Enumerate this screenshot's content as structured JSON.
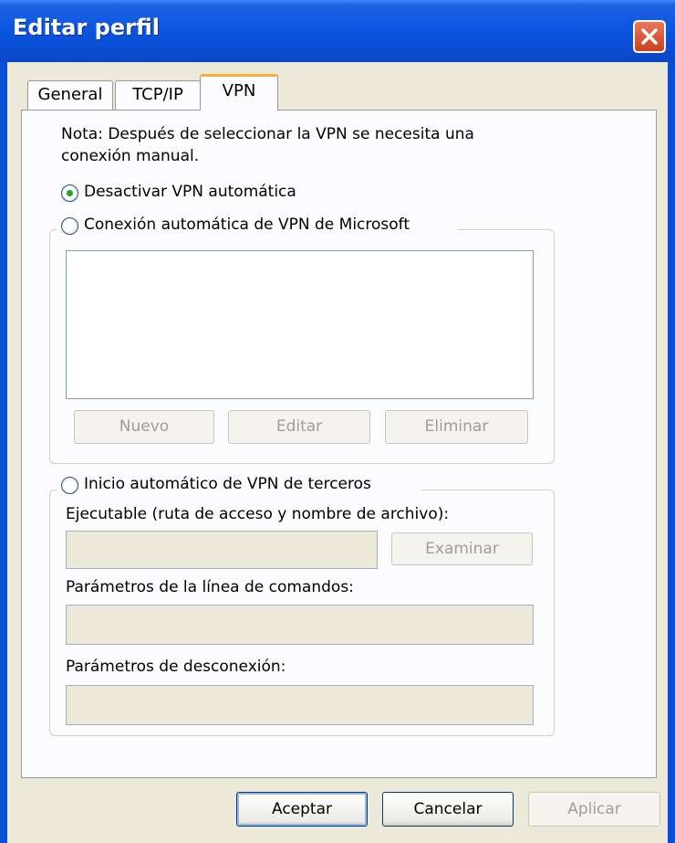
{
  "window": {
    "title": "Editar perfil"
  },
  "tabs": [
    {
      "label": "General"
    },
    {
      "label": "TCP/IP"
    },
    {
      "label": "VPN"
    }
  ],
  "vpn": {
    "note_line1": "Nota: Después de seleccionar la VPN se necesita una",
    "note_line2": "conexión manual.",
    "radio_disable": {
      "label": "Desactivar VPN automática",
      "selected": true
    },
    "radio_microsoft": {
      "label": "Conexión automática de VPN de Microsoft",
      "selected": false
    },
    "microsoft_buttons": {
      "new": "Nuevo",
      "edit": "Editar",
      "delete": "Eliminar"
    },
    "radio_third_party": {
      "label": "Inicio automático de VPN de terceros",
      "selected": false
    },
    "executable_label": "Ejecutable (ruta de acceso y nombre de archivo):",
    "browse_button": "Examinar",
    "cmd_params_label": "Parámetros de la línea de comandos:",
    "disconnect_params_label": "Parámetros de desconexión:",
    "executable_value": "",
    "cmd_params_value": "",
    "disconnect_params_value": ""
  },
  "footer": {
    "ok": "Aceptar",
    "cancel": "Cancelar",
    "apply": "Aplicar"
  },
  "colors": {
    "titlebar": "#0a4fd6",
    "dialog_bg": "#ece9d8",
    "active_tab_accent": "#f5b03a",
    "radio_dot": "#21a121"
  }
}
